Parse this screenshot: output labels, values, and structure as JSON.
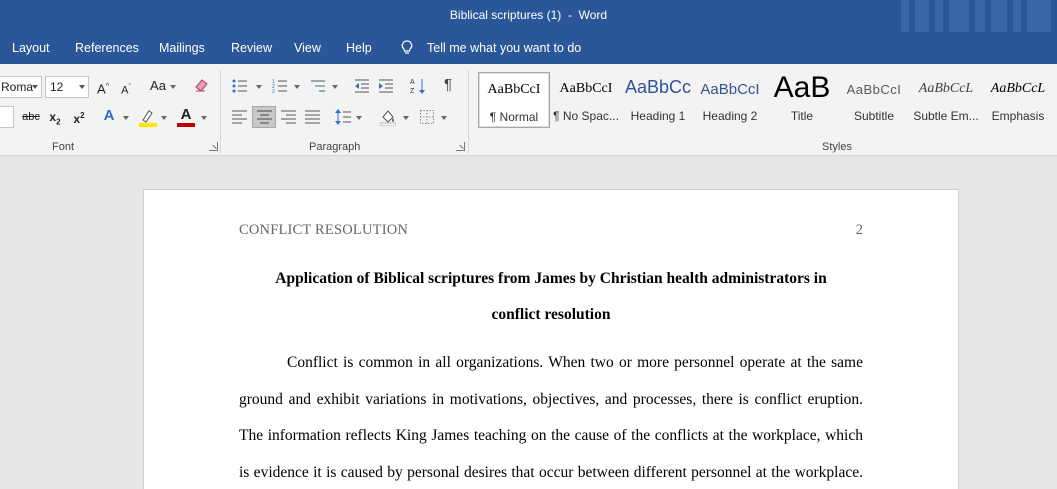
{
  "window": {
    "title": "Biblical scriptures (1)  -  Word"
  },
  "menu": {
    "tabs": [
      "Layout",
      "References",
      "Mailings",
      "Review",
      "View",
      "Help"
    ],
    "tell_me": "Tell me what you want to do"
  },
  "font_group": {
    "font_name": "Roma",
    "font_size": "12",
    "label": "Font",
    "icons": [
      "grow-font-icon",
      "shrink-font-icon",
      "change-case-icon",
      "clear-formatting-icon",
      "strikethrough-icon",
      "subscript-icon",
      "superscript-icon",
      "text-effects-icon",
      "highlight-icon",
      "font-color-icon"
    ],
    "highlight_color": "#ffe600",
    "font_color": "#c00000"
  },
  "paragraph_group": {
    "label": "Paragraph",
    "icons": [
      "bullets-icon",
      "numbering-icon",
      "multilevel-list-icon",
      "decrease-indent-icon",
      "increase-indent-icon",
      "sort-icon",
      "show-marks-icon",
      "align-left-icon",
      "align-center-icon",
      "align-right-icon",
      "justify-icon",
      "line-spacing-icon",
      "shading-icon",
      "borders-icon"
    ]
  },
  "styles_group": {
    "label": "Styles",
    "items": [
      {
        "sample": "AaBbCcI",
        "name": "¶ Normal",
        "selected": true
      },
      {
        "sample": "AaBbCcI",
        "name": "¶ No Spac..."
      },
      {
        "sample": "AaBbCc",
        "name": "Heading 1",
        "color": "#2f5496"
      },
      {
        "sample": "AaBbCcI",
        "name": "Heading 2",
        "color": "#2f5496"
      },
      {
        "sample": "AaB",
        "name": "Title"
      },
      {
        "sample": "AaBbCcI",
        "name": "Subtitle",
        "color": "#595959"
      },
      {
        "sample": "AaBbCcL",
        "name": "Subtle Em...",
        "color": "#404040"
      },
      {
        "sample": "AaBbCcL",
        "name": "Emphasis"
      }
    ]
  },
  "document": {
    "running_head": "CONFLICT RESOLUTION",
    "page_number": "2",
    "title_lines": [
      "Application of Biblical scriptures from James by Christian health administrators in",
      "conflict resolution"
    ],
    "body_lines": [
      "Conflict is common in all organizations. When two or more personnel operate at the same",
      "ground and exhibit variations in motivations, objectives, and processes, there is conflict eruption.",
      "The information reflects King James teaching on the cause of the conflicts at the workplace, which",
      "is evidence it is caused by personal desires that occur between different personnel at the workplace."
    ]
  }
}
